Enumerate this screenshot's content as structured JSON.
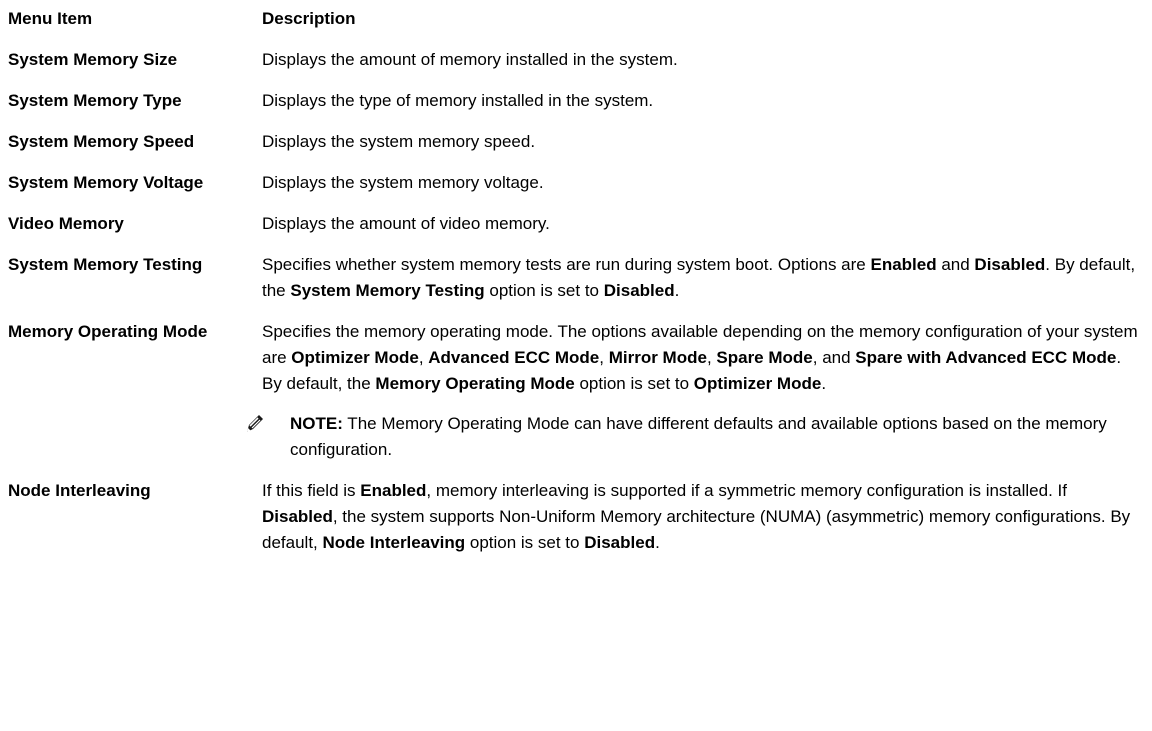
{
  "header": {
    "col_item": "Menu Item",
    "col_desc": "Description"
  },
  "rows": [
    {
      "item": "System Memory Size",
      "desc": [
        {
          "t": "Displays the amount of memory installed in the system."
        }
      ]
    },
    {
      "item": "System Memory Type",
      "desc": [
        {
          "t": "Displays the type of memory installed in the system."
        }
      ]
    },
    {
      "item": "System Memory Speed",
      "desc": [
        {
          "t": "Displays the system memory speed."
        }
      ]
    },
    {
      "item": "System Memory Voltage",
      "desc": [
        {
          "t": "Displays the system memory voltage."
        }
      ]
    },
    {
      "item": "Video Memory",
      "desc": [
        {
          "t": "Displays the amount of video memory."
        }
      ]
    },
    {
      "item": "System Memory Testing",
      "desc": [
        {
          "t": "Specifies whether system memory tests are run during system boot. Options are "
        },
        {
          "t": "Enabled",
          "b": true
        },
        {
          "t": " and "
        },
        {
          "t": "Disabled",
          "b": true
        },
        {
          "t": ". By default, the "
        },
        {
          "t": "System Memory Testing",
          "b": true
        },
        {
          "t": " option is set to "
        },
        {
          "t": "Disabled",
          "b": true
        },
        {
          "t": "."
        }
      ]
    },
    {
      "item": "Memory Operating Mode",
      "desc": [
        {
          "t": "Specifies the memory operating mode. The options available depending on the memory configuration of your system are "
        },
        {
          "t": "Optimizer Mode",
          "b": true
        },
        {
          "t": ", "
        },
        {
          "t": "Advanced ECC Mode",
          "b": true
        },
        {
          "t": ", "
        },
        {
          "t": "Mirror Mode",
          "b": true
        },
        {
          "t": ", "
        },
        {
          "t": "Spare Mode",
          "b": true
        },
        {
          "t": ", and "
        },
        {
          "t": "Spare with Advanced ECC Mode",
          "b": true
        },
        {
          "t": ". By default, the "
        },
        {
          "t": "Memory Operating Mode",
          "b": true
        },
        {
          "t": " option is set to "
        },
        {
          "t": "Optimizer Mode",
          "b": true
        },
        {
          "t": "."
        }
      ],
      "note": {
        "icon": "pencil-icon",
        "label": "NOTE:",
        "text": " The Memory Operating Mode can have different defaults and available options based on the memory configuration."
      }
    },
    {
      "item": "Node Interleaving",
      "desc": [
        {
          "t": "If this field is "
        },
        {
          "t": "Enabled",
          "b": true
        },
        {
          "t": ", memory interleaving is supported if a symmetric memory configuration is installed. If "
        },
        {
          "t": "Disabled",
          "b": true
        },
        {
          "t": ", the system supports Non-Uniform Memory architecture (NUMA) (asymmetric) memory configurations. By default, "
        },
        {
          "t": "Node Interleaving",
          "b": true
        },
        {
          "t": " option is set to "
        },
        {
          "t": "Disabled",
          "b": true
        },
        {
          "t": "."
        }
      ]
    }
  ]
}
